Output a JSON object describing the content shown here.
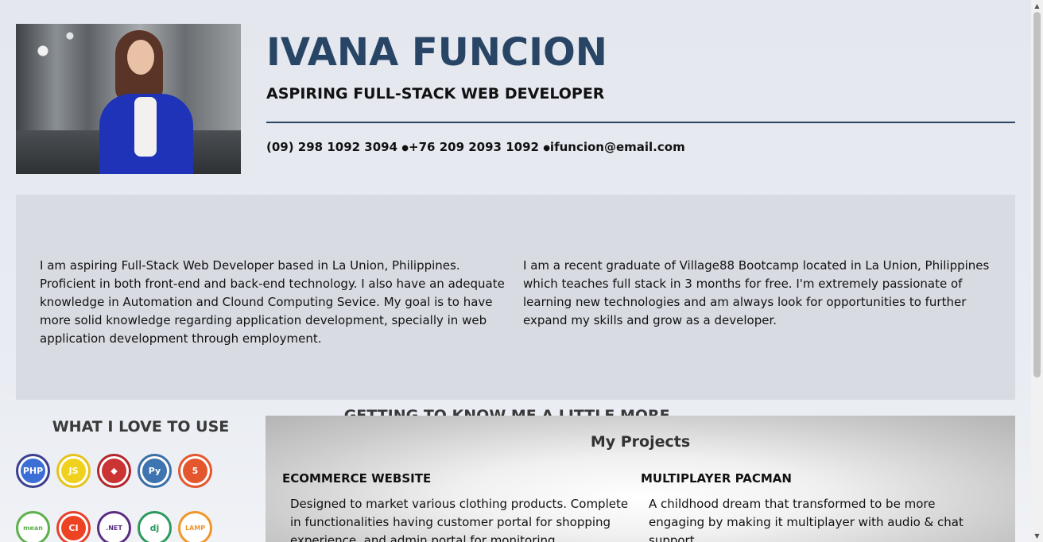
{
  "header": {
    "name": "IVANA FUNCION",
    "role": "ASPIRING FULL-STACK WEB DEVELOPER",
    "contact": {
      "phone1": "(09) 298 1092 3094",
      "phone2": "+76 209 2093 1092",
      "email": "ifuncion@email.com",
      "separator": "●"
    }
  },
  "about": {
    "title": "GETTING TO KNOW ME A LITTLE MORE...",
    "left": "I am aspiring Full-Stack Web Developer based in La Union, Philippines. Proficient in both front-end and back-end technology. I also have an adequate knowledge in Automation and Clound Computing Sevice. My goal is to have more solid knowledge regarding application development, specially in web application development through employment.",
    "right": "I am a recent graduate of Village88 Bootcamp located in La Union, Philippines which teaches full stack in 3 months for free. I'm extremely passionate of learning new technologies and am always look for opportunities to further expand my skills and grow as a developer."
  },
  "skills": {
    "title": "WHAT I LOVE TO USE",
    "icons": [
      {
        "name": "php-icon",
        "label": "PHP",
        "ring": "#3b3f8f",
        "fill": "#3b6fd6"
      },
      {
        "name": "javascript-icon",
        "label": "JS",
        "ring": "#e6c21a",
        "fill": "#f0d21e"
      },
      {
        "name": "ruby-icon",
        "label": "◆",
        "ring": "#b3262b",
        "fill": "#cc3333"
      },
      {
        "name": "python-icon",
        "label": "Py",
        "ring": "#3a6ea5",
        "fill": "#3e74b0"
      },
      {
        "name": "html5-icon",
        "label": "5",
        "ring": "#e4572e",
        "fill": "#e4572e"
      },
      {
        "name": "mean-icon",
        "label": "mean",
        "ring": "#5cb04a",
        "fill": "#ffffff"
      },
      {
        "name": "codeigniter-icon",
        "label": "CI",
        "ring": "#e4402a",
        "fill": "#ee4323"
      },
      {
        "name": "dotnet-icon",
        "label": ".NET",
        "ring": "#5a2d82",
        "fill": "#ffffff"
      },
      {
        "name": "django-icon",
        "label": "dj",
        "ring": "#2a9a5c",
        "fill": "#ffffff"
      },
      {
        "name": "lamp-icon",
        "label": "LAMP",
        "ring": "#f0962a",
        "fill": "#ffffff"
      }
    ]
  },
  "projects": {
    "title": "My Projects",
    "items": [
      {
        "name": "ECOMMERCE WEBSITE",
        "desc": "Designed to market various clothing products. Complete in functionalities having customer portal for shopping experience, and admin portal for monitoring"
      },
      {
        "name": "MULTIPLAYER PACMAN",
        "desc": "A childhood dream that transformed to be more engaging by making it multiplayer with audio & chat support."
      }
    ]
  },
  "scrollbar": {
    "up": "▲",
    "down": "▼"
  }
}
